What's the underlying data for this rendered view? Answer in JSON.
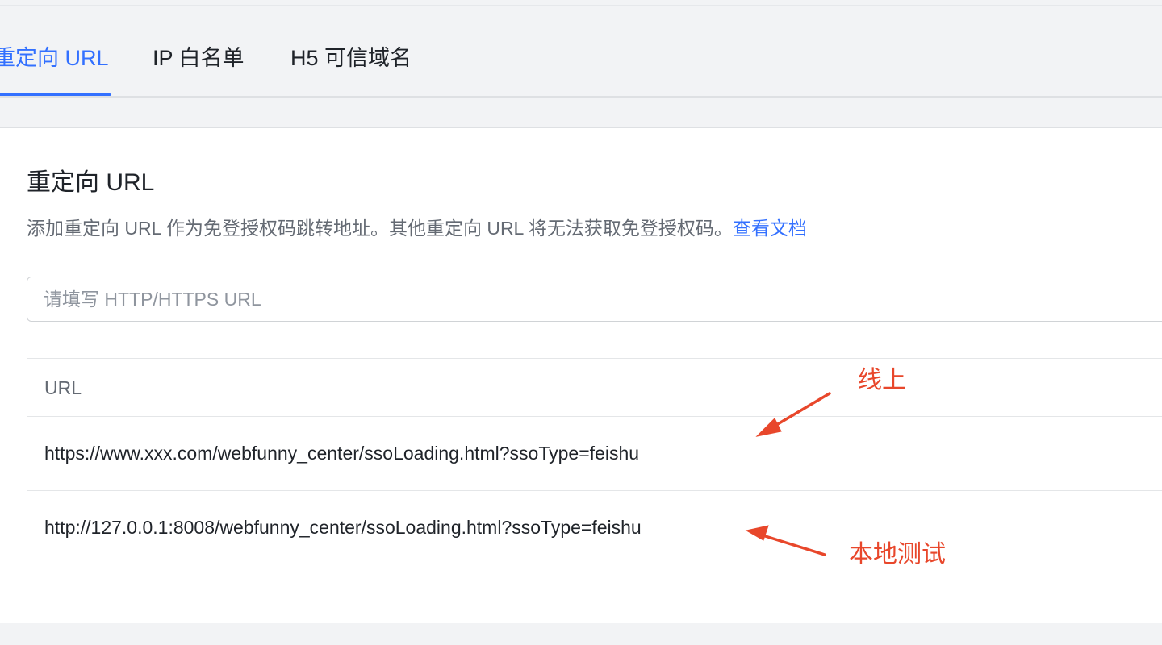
{
  "tabs": [
    {
      "label": "重定向 URL",
      "active": true
    },
    {
      "label": "IP 白名单",
      "active": false
    },
    {
      "label": "H5 可信域名",
      "active": false
    }
  ],
  "section": {
    "title": "重定向 URL",
    "description": "添加重定向 URL 作为免登授权码跳转地址。其他重定向 URL 将无法获取免登授权码。",
    "doc_link": "查看文档"
  },
  "input": {
    "placeholder": "请填写 HTTP/HTTPS URL",
    "value": ""
  },
  "table": {
    "header": "URL",
    "rows": [
      "https://www.xxx.com/webfunny_center/ssoLoading.html?ssoType=feishu",
      "http://127.0.0.1:8008/webfunny_center/ssoLoading.html?ssoType=feishu"
    ]
  },
  "annotations": {
    "online": "线上",
    "local": "本地测试",
    "color": "#e8472b"
  },
  "colors": {
    "accent": "#3370ff",
    "text": "#1f2329",
    "muted": "#646a73"
  }
}
